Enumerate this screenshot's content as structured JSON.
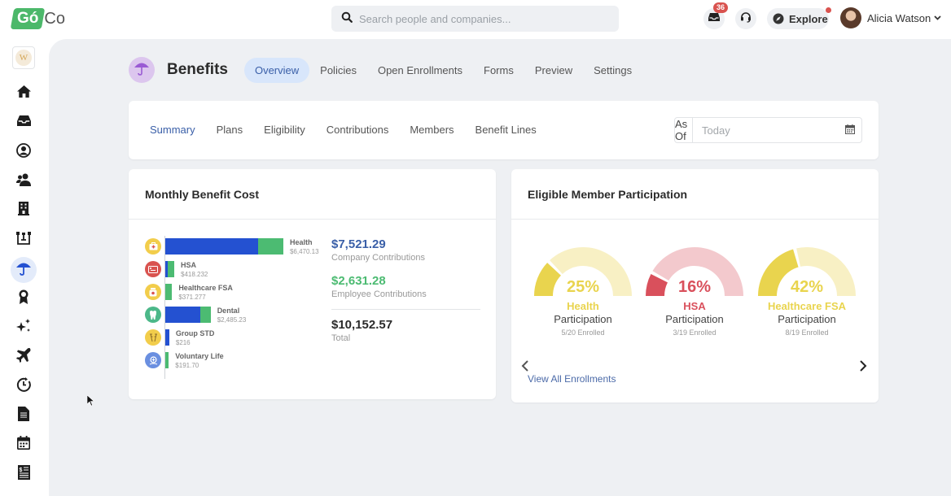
{
  "app": {
    "logo_go": "Gó",
    "logo_co": "Co"
  },
  "topbar": {
    "search_placeholder": "Search people and companies...",
    "inbox_badge": "36",
    "explore_label": "Explore",
    "user_name": "Alicia Watson",
    "icons": [
      "inbox-icon",
      "headset-icon",
      "compass-icon",
      "chevron-down-icon"
    ]
  },
  "sidebar": {
    "company_initial": "W",
    "items": [
      {
        "name": "home",
        "icon": "home-icon"
      },
      {
        "name": "inbox",
        "icon": "inbox-tray-icon"
      },
      {
        "name": "profile",
        "icon": "user-circle-icon"
      },
      {
        "name": "people",
        "icon": "users-icon"
      },
      {
        "name": "company",
        "icon": "building-icon"
      },
      {
        "name": "org-chart",
        "icon": "org-chart-icon"
      },
      {
        "name": "benefits",
        "icon": "umbrella-icon",
        "active": true
      },
      {
        "name": "awards",
        "icon": "award-icon"
      },
      {
        "name": "sparkles",
        "icon": "sparkles-icon"
      },
      {
        "name": "time-off",
        "icon": "plane-icon"
      },
      {
        "name": "time-tracking",
        "icon": "clock-icon"
      },
      {
        "name": "documents",
        "icon": "document-icon"
      },
      {
        "name": "calendar",
        "icon": "calendar-icon"
      },
      {
        "name": "payroll",
        "icon": "payroll-icon"
      }
    ]
  },
  "page": {
    "title": "Benefits",
    "tabs": [
      {
        "label": "Overview",
        "active": true
      },
      {
        "label": "Policies"
      },
      {
        "label": "Open Enrollments"
      },
      {
        "label": "Forms"
      },
      {
        "label": "Preview"
      },
      {
        "label": "Settings"
      }
    ]
  },
  "subnav": {
    "tabs": [
      {
        "label": "Summary",
        "active": true
      },
      {
        "label": "Plans"
      },
      {
        "label": "Eligibility"
      },
      {
        "label": "Contributions"
      },
      {
        "label": "Members"
      },
      {
        "label": "Benefit Lines"
      }
    ],
    "as_of_label": "As Of",
    "date_placeholder": "Today"
  },
  "cost_card": {
    "title": "Monthly Benefit Cost",
    "company_total": "$7,521.29",
    "company_label": "Company Contributions",
    "employee_total": "$2,631.28",
    "employee_label": "Employee Contributions",
    "grand_total": "$10,152.57",
    "total_label": "Total",
    "colors": {
      "company": "#2451d1",
      "employee": "#4cbb72",
      "company_text": "#3a5fa8",
      "employee_text": "#4cbb72"
    }
  },
  "chart_data": {
    "type": "bar",
    "orientation": "horizontal",
    "stacked": true,
    "title": "Monthly Benefit Cost",
    "categories": [
      "Health",
      "HSA",
      "Healthcare FSA",
      "Dental",
      "Group STD",
      "Voluntary Life"
    ],
    "amount_labels": [
      "$6,470.13",
      "$418.232",
      "$371.277",
      "$2,485.23",
      "$216",
      "$191.70"
    ],
    "totals": [
      6470.13,
      418.23,
      371.28,
      2485.23,
      216,
      191.7
    ],
    "series": [
      {
        "name": "Company Contributions",
        "color": "#2451d1",
        "values": [
          5070,
          60,
          0,
          1920,
          216,
          0
        ]
      },
      {
        "name": "Employee Contributions",
        "color": "#4cbb72",
        "values": [
          1400,
          358,
          371,
          565,
          0,
          192
        ]
      }
    ],
    "category_icons": [
      {
        "icon": "medical-kit-icon",
        "bg": "#f2cd4b",
        "fg": "#d9534f"
      },
      {
        "icon": "card-icon",
        "bg": "#d9534f",
        "fg": "#ffffff"
      },
      {
        "icon": "jar-icon",
        "bg": "#f2cd4b",
        "fg": "#d9534f"
      },
      {
        "icon": "tooth-icon",
        "bg": "#4cb889",
        "fg": "#ffffff"
      },
      {
        "icon": "crutches-icon",
        "bg": "#f2cd4b",
        "fg": "#8a6a2a"
      },
      {
        "icon": "life-icon",
        "bg": "#6a8fe0",
        "fg": "#ffffff"
      }
    ]
  },
  "participation_card": {
    "title": "Eligible Member Participation",
    "view_all_label": "View All Enrollments",
    "gauges": [
      {
        "name": "Health",
        "percent": 25,
        "percent_label": "25%",
        "sub": "Participation",
        "enrolled": "5/20 Enrolled",
        "color": "#e9d44e",
        "track": "#f8f0c4"
      },
      {
        "name": "HSA",
        "percent": 16,
        "percent_label": "16%",
        "sub": "Participation",
        "enrolled": "3/19 Enrolled",
        "color": "#d9505c",
        "track": "#f3c9cd"
      },
      {
        "name": "Healthcare FSA",
        "percent": 42,
        "percent_label": "42%",
        "sub": "Participation",
        "enrolled": "8/19 Enrolled",
        "color": "#e9d44e",
        "track": "#f8f0c4"
      }
    ]
  }
}
